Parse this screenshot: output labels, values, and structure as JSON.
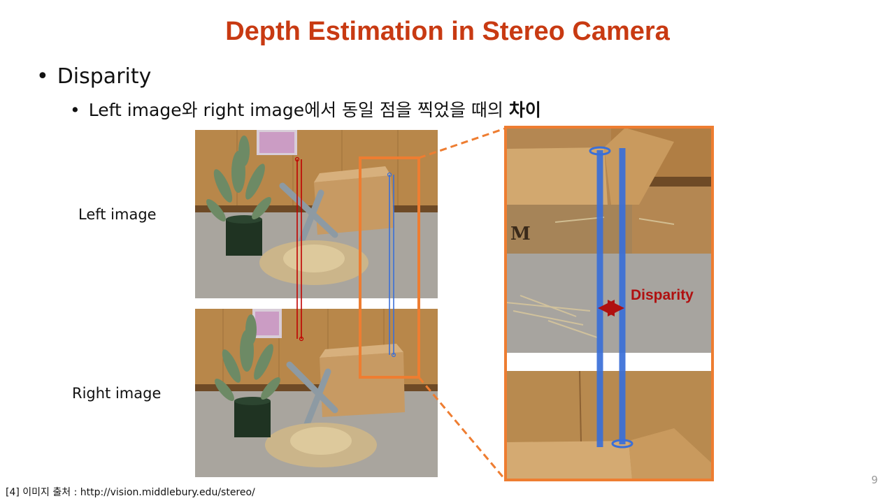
{
  "slide": {
    "title": "Depth Estimation in Stereo Camera",
    "bullet_level1": "Disparity",
    "bullet_level2_prefix": "Left image와 right image에서 동일 점을 찍었을 때의 ",
    "bullet_level2_bold": "차이",
    "left_image_label": "Left image",
    "right_image_label": "Right image",
    "disparity_label": "Disparity",
    "footer": "[4] 이미지 출처 : http://vision.middlebury.edu/stereo/",
    "page_number": "9"
  },
  "colors": {
    "title": "#c83a12",
    "highlight_frame": "#ee7d31",
    "disparity_arrow": "#b01010",
    "left_correspondence_line": "#c00000",
    "right_correspondence_line": "#3a6fd8"
  }
}
